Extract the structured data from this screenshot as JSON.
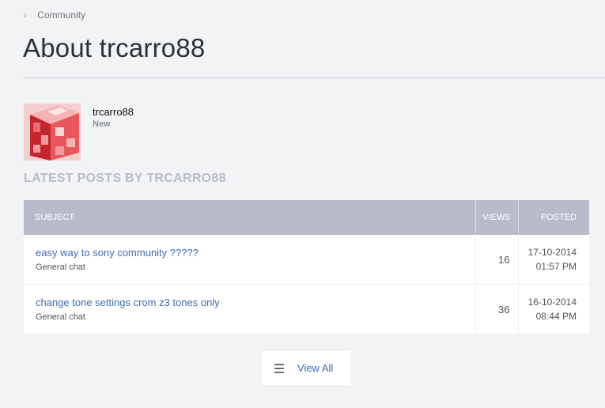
{
  "breadcrumb": {
    "item": "Community"
  },
  "page": {
    "title": "About trcarro88"
  },
  "profile": {
    "username": "trcarro88",
    "rank": "New"
  },
  "posts": {
    "heading": "LATEST POSTS BY TRCARRO88",
    "columns": {
      "subject": "SUBJECT",
      "views": "VIEWS",
      "posted": "POSTED"
    },
    "rows": [
      {
        "subject": "easy way to sony community ?????",
        "board": "General chat",
        "views": "16",
        "date": "17-10-2014",
        "time": "01:57 PM"
      },
      {
        "subject": "change tone settings crom z3 tones only",
        "board": "General chat",
        "views": "36",
        "date": "16-10-2014",
        "time": "08:44 PM"
      }
    ]
  },
  "view_all": {
    "label": "View All",
    "icon": "list-icon"
  },
  "colors": {
    "link": "#3f6ab2",
    "table_header": "#b9bbcb",
    "heading": "#b9bcc9",
    "background": "#f2f3f4"
  }
}
